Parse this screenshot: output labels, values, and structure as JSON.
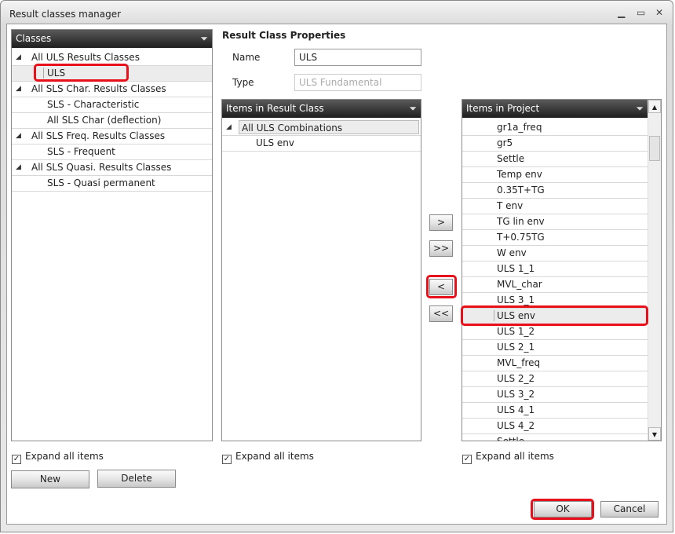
{
  "window": {
    "title": "Result classes manager",
    "minimize": "▁",
    "maximize": "▭",
    "close": "✕"
  },
  "classes": {
    "header": "Classes",
    "items": [
      {
        "label": "All ULS Results Classes",
        "group": true
      },
      {
        "label": "ULS",
        "group": false
      },
      {
        "label": "All SLS Char. Results Classes",
        "group": true
      },
      {
        "label": "SLS - Characteristic",
        "group": false
      },
      {
        "label": "All SLS Char (deflection)",
        "group": false
      },
      {
        "label": "All SLS Freq. Results Classes",
        "group": true
      },
      {
        "label": "SLS - Frequent",
        "group": false
      },
      {
        "label": "All SLS Quasi. Results Classes",
        "group": true
      },
      {
        "label": "SLS - Quasi permanent",
        "group": false
      }
    ],
    "expand_label": "Expand all items",
    "new_label": "New",
    "delete_label": "Delete"
  },
  "properties": {
    "title": "Result Class Properties",
    "name_label": "Name",
    "name_value": "ULS",
    "type_label": "Type",
    "type_placeholder": "ULS Fundamental"
  },
  "result_class_items": {
    "header": "Items in Result Class",
    "group": "All ULS Combinations",
    "items": [
      "ULS env"
    ],
    "expand_label": "Expand all items"
  },
  "transfer": {
    "add": ">",
    "add_all": ">>",
    "remove": "<",
    "remove_all": "<<"
  },
  "project_items": {
    "header": "Items in Project",
    "items": [
      "gr1a_freq",
      "gr5",
      "Settle",
      "Temp env",
      "0.35T+TG",
      "T env",
      "TG lin env",
      "T+0.75TG",
      "W env",
      "ULS 1_1",
      "MVL_char",
      "ULS 3_1",
      "ULS env",
      "ULS 1_2",
      "ULS 2_1",
      "MVL_freq",
      "ULS 2_2",
      "ULS 3_2",
      "ULS 4_1",
      "ULS 4_2",
      "Settle"
    ],
    "selected": "ULS env",
    "expand_label": "Expand all items"
  },
  "footer": {
    "ok": "OK",
    "cancel": "Cancel"
  },
  "icons": {
    "filter": "▼",
    "expand": "◢",
    "check": "✓",
    "scroll_up": "▲",
    "scroll_down": "▼"
  }
}
